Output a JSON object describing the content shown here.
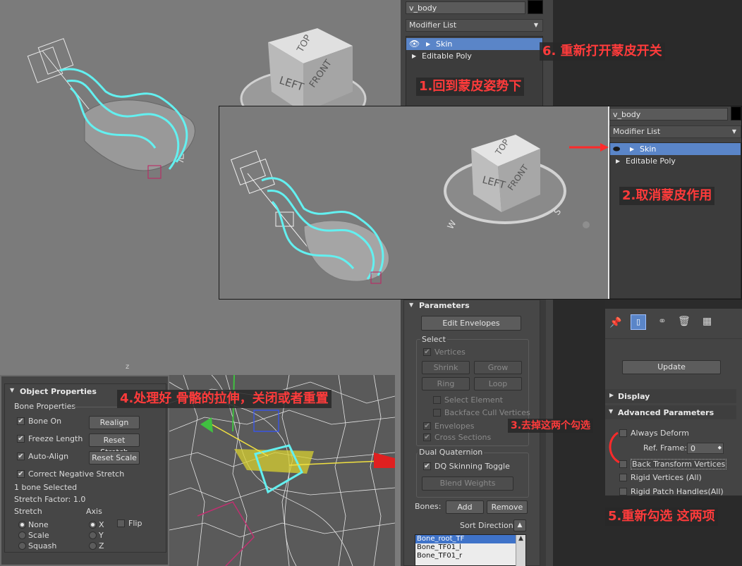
{
  "top": {
    "object_name": "v_body",
    "modifier_list": "Modifier List",
    "stack": [
      "Skin",
      "Editable Poly"
    ],
    "nav_cube": {
      "top": "TOP",
      "left": "LEFT",
      "front": "FRONT"
    }
  },
  "inset": {
    "object_name": "v_body",
    "modifier_list": "Modifier List",
    "stack": [
      "Skin",
      "Editable Poly"
    ],
    "nav_cube": {
      "top": "TOP",
      "left": "LEFT",
      "front": "FRONT",
      "compass_s": "S",
      "compass_w": "W"
    }
  },
  "annotations": {
    "a1": "1.回到蒙皮姿势下",
    "a2": "2.取消蒙皮作用",
    "a3": "3.去掉这两个勾选",
    "a4": "4.处理好 骨骼的拉伸，关闭或者重置",
    "a5": "5.重新勾选 这两项",
    "a6": "6. 重新打开蒙皮开关"
  },
  "parameters": {
    "title": "Parameters",
    "edit_envelopes": "Edit Envelopes",
    "select_label": "Select",
    "vertices": "Vertices",
    "shrink": "Shrink",
    "grow": "Grow",
    "ring": "Ring",
    "loop": "Loop",
    "select_element": "Select Element",
    "backface_cull": "Backface Cull Vertices",
    "envelopes": "Envelopes",
    "cross_sections": "Cross Sections",
    "dual_quaternion": "Dual Quaternion",
    "dq_toggle": "DQ Skinning Toggle",
    "blend_weights": "Blend Weights",
    "bones_label": "Bones:",
    "add": "Add",
    "remove": "Remove",
    "sort_direction": "Sort Direction:",
    "bone_list": [
      "Bone_root_TF",
      "Bone_TF01_l",
      "Bone_TF01_r"
    ]
  },
  "advanced": {
    "update": "Update",
    "display": "Display",
    "title": "Advanced Parameters",
    "always_deform": "Always Deform",
    "ref_frame_label": "Ref. Frame:",
    "ref_frame_value": "0",
    "back_transform": "Back Transform Vertices",
    "rigid_vertices": "Rigid Vertices (All)",
    "rigid_patch": "Rigid Patch Handles(All)"
  },
  "object_properties": {
    "title": "Object Properties",
    "bone_properties": "Bone Properties",
    "bone_on": "Bone On",
    "realign": "Realign",
    "freeze_length": "Freeze Length",
    "reset_stretch": "Reset Stretch",
    "auto_align": "Auto-Align",
    "reset_scale": "Reset Scale",
    "correct_negative": "Correct Negative Stretch",
    "bones_selected": "1 bone Selected",
    "stretch_factor": "Stretch Factor: 1.0",
    "stretch_label": "Stretch",
    "axis_label": "Axis",
    "none": "None",
    "scale": "Scale",
    "squash": "Squash",
    "x": "X",
    "y": "Y",
    "z": "Z",
    "flip": "Flip"
  },
  "viewport": {
    "z_axis": "z"
  },
  "colors": {
    "annotation": "#ff3b3b",
    "selection": "#5a85c8",
    "wire": "#63f0f0"
  }
}
